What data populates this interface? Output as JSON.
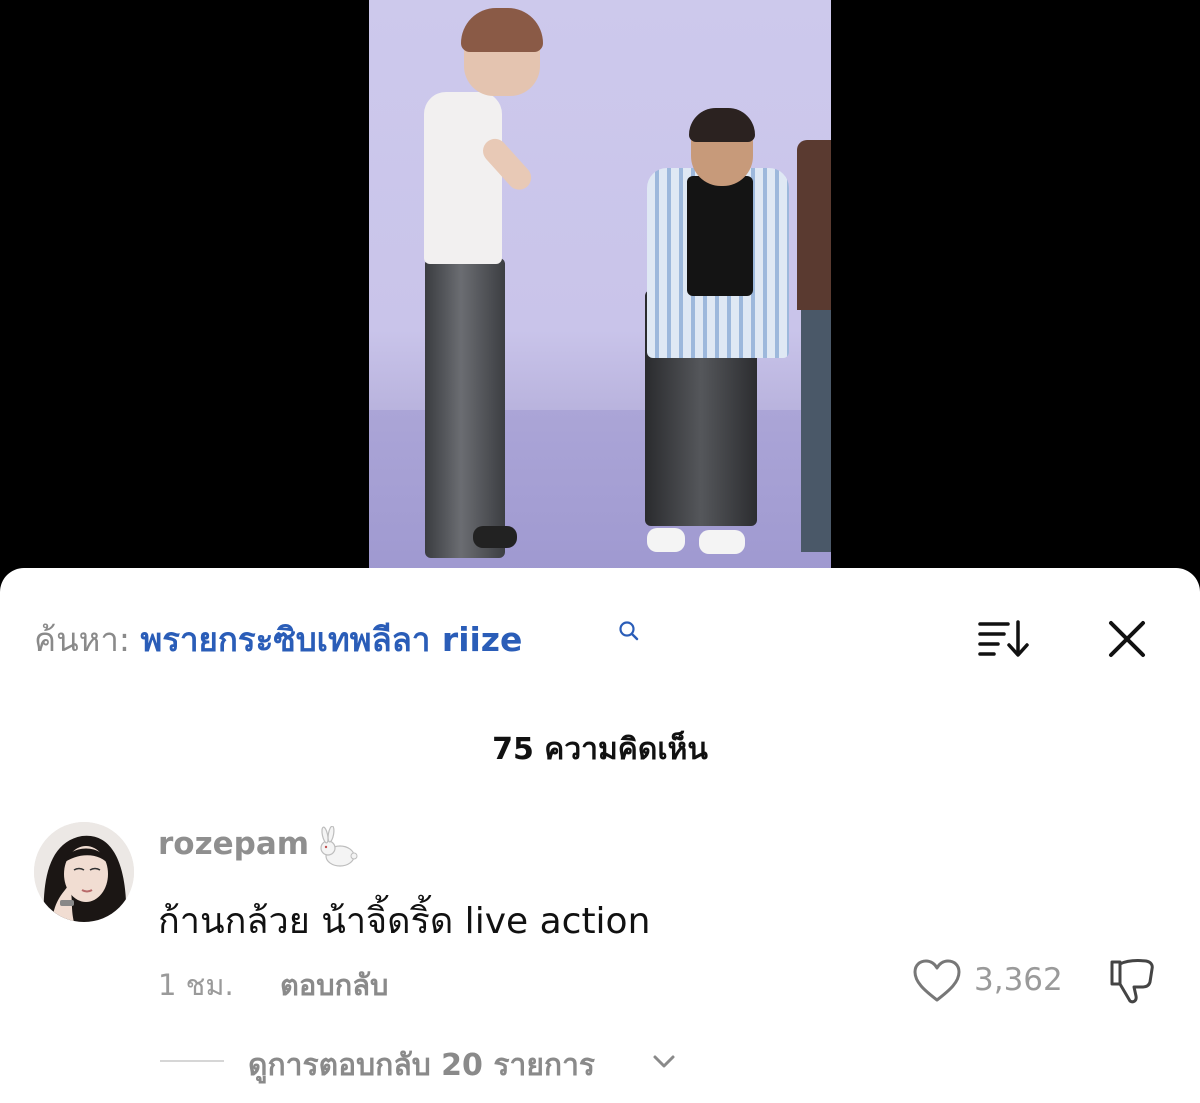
{
  "search": {
    "prefix": "ค้นหา:",
    "query": "พรายกระซิบเทพลีลา riize"
  },
  "comments_header": {
    "count_label": "75 ความคิดเห็น"
  },
  "comment": {
    "username": "rozepam",
    "username_emoji": "rabbit-icon",
    "text": "ก้านกล้วย น้าจิ้ดริ้ด live action",
    "timestamp": "1 ชม.",
    "reply_label": "ตอบกลับ",
    "like_count": "3,362",
    "view_replies_label": "ดูการตอบกลับ 20 รายการ"
  },
  "icons": {
    "sort": "sort-icon",
    "close": "close-icon",
    "search": "search-icon",
    "like": "heart-icon",
    "dislike": "thumbs-down-icon",
    "expand": "chevron-down-icon"
  },
  "colors": {
    "search_query": "#2a5db8",
    "muted_text": "#8a8a8a",
    "sheet_background": "#ffffff"
  }
}
